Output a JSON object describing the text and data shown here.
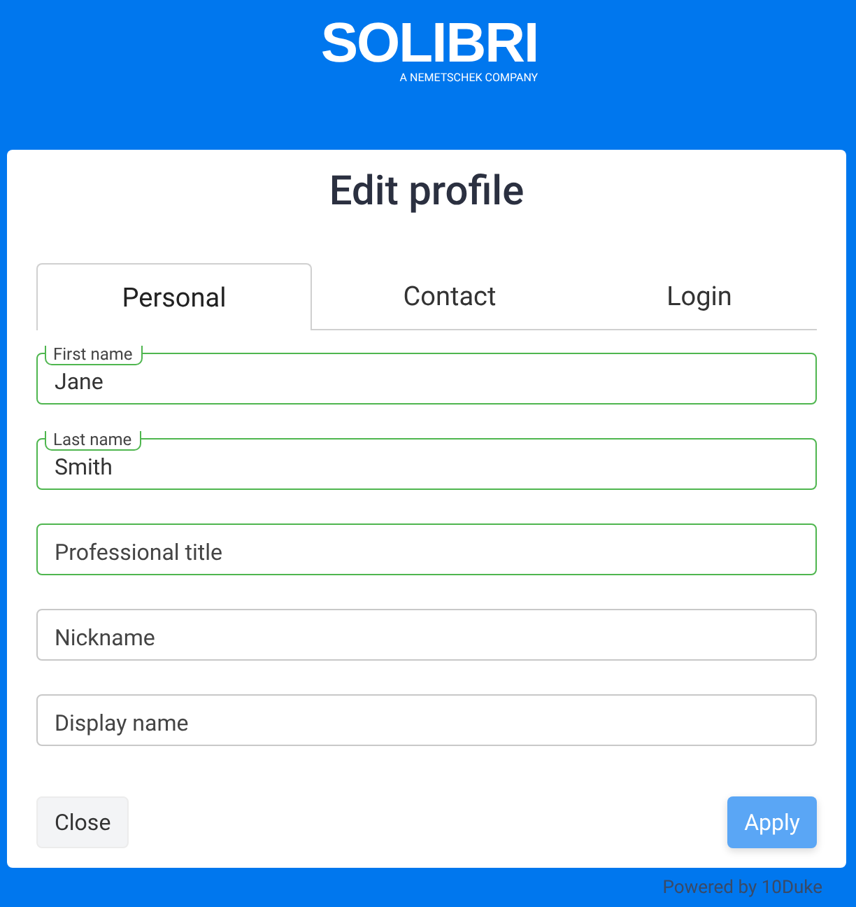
{
  "logo": {
    "name": "SOLIBRI",
    "tagline": "A NEMETSCHEK COMPANY"
  },
  "title": "Edit profile",
  "tabs": [
    {
      "label": "Personal",
      "selected": true
    },
    {
      "label": "Contact",
      "selected": false
    },
    {
      "label": "Login",
      "selected": false
    }
  ],
  "fields": [
    {
      "label": "First name",
      "value": "Jane",
      "valid": true
    },
    {
      "label": "Last name",
      "value": "Smith",
      "valid": true
    },
    {
      "placeholder": "Professional title",
      "valid": true
    },
    {
      "placeholder": "Nickname",
      "valid": false
    },
    {
      "placeholder": "Display name",
      "valid": false
    }
  ],
  "buttons": {
    "close": {
      "label": "Close",
      "disabled": false
    },
    "apply": {
      "label": "Apply",
      "disabled": true
    }
  },
  "footer": "Powered by 10Duke"
}
